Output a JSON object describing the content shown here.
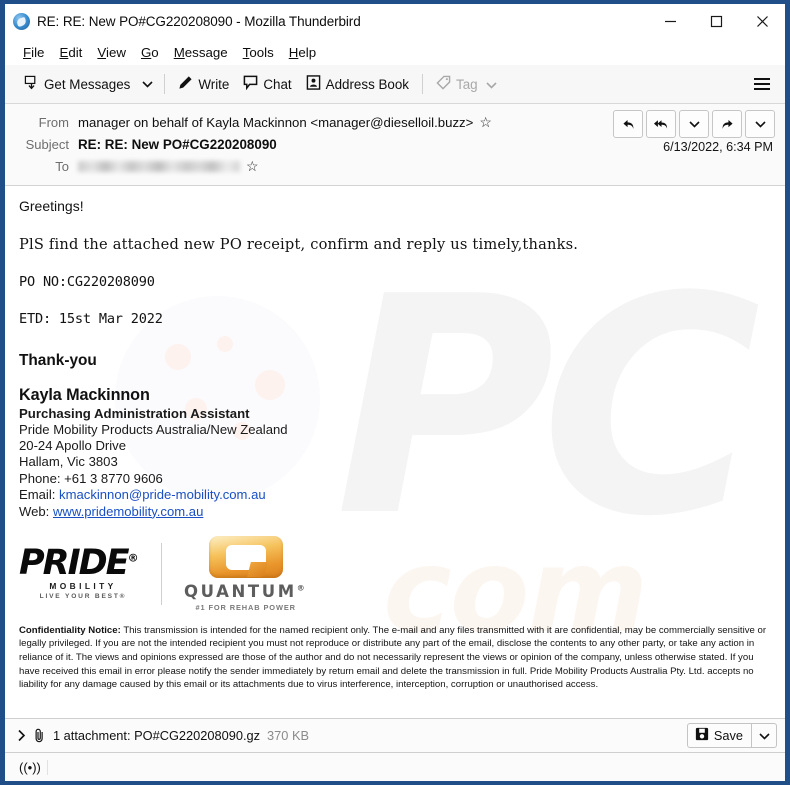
{
  "window": {
    "title": "RE: RE: New PO#CG220208090 - Mozilla Thunderbird",
    "logo_icon": "thunderbird-icon",
    "controls": {
      "minimize": "minimize-icon",
      "maximize": "maximize-icon",
      "close": "close-icon"
    }
  },
  "menubar": {
    "items": [
      {
        "label": "File",
        "accesskey": "F"
      },
      {
        "label": "Edit",
        "accesskey": "E"
      },
      {
        "label": "View",
        "accesskey": "V"
      },
      {
        "label": "Go",
        "accesskey": "G"
      },
      {
        "label": "Message",
        "accesskey": "M"
      },
      {
        "label": "Tools",
        "accesskey": "T"
      },
      {
        "label": "Help",
        "accesskey": "H"
      }
    ]
  },
  "toolbar": {
    "get_messages": "Get Messages",
    "write": "Write",
    "chat": "Chat",
    "address_book": "Address Book",
    "tag": "Tag",
    "tag_disabled": true,
    "menu_icon": "hamburger-icon"
  },
  "header": {
    "from_label": "From",
    "from_value": "manager on behalf of Kayla Mackinnon <manager@dieselloil.buzz>",
    "subject_label": "Subject",
    "subject_value": "RE: RE: New PO#CG220208090",
    "to_label": "To",
    "to_value": "",
    "to_redacted": true,
    "date": "6/13/2022, 6:34 PM",
    "actions": [
      "reply-icon",
      "reply-all-icon",
      "reply-menu-chevron-icon",
      "forward-icon",
      "more-actions-chevron-icon"
    ]
  },
  "body": {
    "greeting": "Greetings!",
    "line1": "PlS find the attached new PO receipt, confirm and reply us timely,thanks.",
    "line2": "PO NO:CG220208090",
    "line3": "ETD: 15st Mar 2022",
    "closing": "Thank-you"
  },
  "signature": {
    "name": "Kayla Mackinnon",
    "title": "Purchasing Administration Assistant",
    "company": "Pride Mobility Products Australia/New Zealand",
    "address1": "20-24 Apollo Drive",
    "address2": "Hallam, Vic 3803",
    "phone_label": "Phone:",
    "phone_value": "+61 3 8770 9606",
    "email_label": "Email:",
    "email_value": "kmackinnon@pride-mobility.com.au",
    "web_label": "Web:",
    "web_value": "www.pridemobility.com.au",
    "link_color": "#1a4fc4"
  },
  "logos": {
    "pride": {
      "word": "PRIDE",
      "registered": "®",
      "sub1": "MOBILITY",
      "sub2": "LIVE YOUR BEST®"
    },
    "quantum": {
      "word": "QUANTUM",
      "registered": "®",
      "tagline": "#1 FOR REHAB POWER",
      "accent_color": "#e9952c"
    }
  },
  "confidentiality": {
    "heading": "Confidentiality Notice:",
    "text": "This transmission is intended for the named recipient only. The e-mail and any files transmitted with it are confidential, may be commercially sensitive or legally privileged. If you are not the intended recipient you must not reproduce or distribute any part of the email, disclose the contents to any other party, or take any action in reliance of it. The views and opinions expressed are those of the author and do not necessarily represent the views or opinion of the company, unless otherwise stated. If you have received this email in error please notify the sender immediately by return email and delete the transmission in full. Pride Mobility Products Australia Pty. Ltd. accepts no liability for any damage caused by this email or its attachments due to virus interference, interception, corruption or unauthorised access."
  },
  "attachment": {
    "expand_icon": "chevron-right-icon",
    "clip_icon": "paperclip-icon",
    "label": "1 attachment: PO#CG220208090.gz",
    "size": "370 KB",
    "save_label": "Save",
    "save_icon": "floppy-disk-icon",
    "save_caret_icon": "chevron-down-icon"
  },
  "statusbar": {
    "icon": "((•))",
    "icon_name": "online-status-icon"
  },
  "watermark": {
    "text_top": "PC",
    "text_bottom": "com"
  }
}
